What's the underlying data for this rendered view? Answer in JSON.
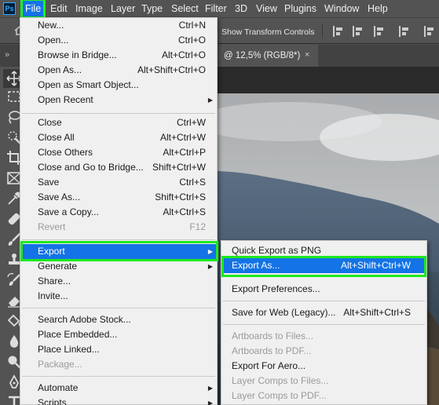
{
  "app": {
    "logo": "Ps"
  },
  "menubar": {
    "items": [
      "File",
      "Edit",
      "Image",
      "Layer",
      "Type",
      "Select",
      "Filter",
      "3D",
      "View",
      "Plugins",
      "Window",
      "Help"
    ]
  },
  "options": {
    "show_transform_controls": "Show Transform Controls",
    "show_transform_checked": false
  },
  "tabs": {
    "collapse_glyph": "»",
    "document_title": "@ 12,5% (RGB/8*)",
    "close_glyph": "×"
  },
  "file_menu": {
    "items": [
      {
        "label": "New...",
        "shortcut": "Ctrl+N"
      },
      {
        "label": "Open...",
        "shortcut": "Ctrl+O"
      },
      {
        "label": "Browse in Bridge...",
        "shortcut": "Alt+Ctrl+O"
      },
      {
        "label": "Open As...",
        "shortcut": "Alt+Shift+Ctrl+O"
      },
      {
        "label": "Open as Smart Object...",
        "shortcut": ""
      },
      {
        "label": "Open Recent",
        "shortcut": "",
        "submenu": true
      },
      {
        "label": "Close",
        "shortcut": "Ctrl+W"
      },
      {
        "label": "Close All",
        "shortcut": "Alt+Ctrl+W"
      },
      {
        "label": "Close Others",
        "shortcut": "Alt+Ctrl+P"
      },
      {
        "label": "Close and Go to Bridge...",
        "shortcut": "Shift+Ctrl+W"
      },
      {
        "label": "Save",
        "shortcut": "Ctrl+S"
      },
      {
        "label": "Save As...",
        "shortcut": "Shift+Ctrl+S"
      },
      {
        "label": "Save a Copy...",
        "shortcut": "Alt+Ctrl+S"
      },
      {
        "label": "Revert",
        "shortcut": "F12",
        "disabled": true
      },
      {
        "label": "Export",
        "shortcut": "",
        "submenu": true,
        "highlighted": true
      },
      {
        "label": "Generate",
        "shortcut": "",
        "submenu": true
      },
      {
        "label": "Share...",
        "shortcut": ""
      },
      {
        "label": "Invite...",
        "shortcut": ""
      },
      {
        "label": "Search Adobe Stock...",
        "shortcut": ""
      },
      {
        "label": "Place Embedded...",
        "shortcut": ""
      },
      {
        "label": "Place Linked...",
        "shortcut": ""
      },
      {
        "label": "Package...",
        "shortcut": "",
        "disabled": true
      },
      {
        "label": "Automate",
        "shortcut": "",
        "submenu": true
      },
      {
        "label": "Scripts",
        "shortcut": "",
        "submenu": true
      }
    ]
  },
  "export_menu": {
    "items": [
      {
        "label": "Quick Export as PNG",
        "shortcut": ""
      },
      {
        "label": "Export As...",
        "shortcut": "Alt+Shift+Ctrl+W",
        "highlighted": true
      },
      {
        "label": "Export Preferences...",
        "shortcut": ""
      },
      {
        "label": "Save for Web (Legacy)...",
        "shortcut": "Alt+Shift+Ctrl+S"
      },
      {
        "label": "Artboards to Files...",
        "shortcut": "",
        "disabled": true
      },
      {
        "label": "Artboards to PDF...",
        "shortcut": "",
        "disabled": true
      },
      {
        "label": "Export For Aero...",
        "shortcut": ""
      },
      {
        "label": "Layer Comps to Files...",
        "shortcut": "",
        "disabled": true
      },
      {
        "label": "Layer Comps to PDF...",
        "shortcut": "",
        "disabled": true
      }
    ]
  },
  "colors": {
    "highlight": "#1473e6",
    "annotation": "#1ee81e",
    "chrome": "#535353"
  },
  "toolbar_icons": [
    "move-tool-icon",
    "marquee-tool-icon",
    "lasso-tool-icon",
    "quick-select-tool-icon",
    "crop-tool-icon",
    "frame-tool-icon",
    "eyedropper-tool-icon",
    "healing-brush-tool-icon",
    "brush-tool-icon",
    "clone-stamp-tool-icon",
    "history-brush-tool-icon",
    "eraser-tool-icon",
    "paint-bucket-tool-icon",
    "blur-tool-icon",
    "dodge-tool-icon",
    "pen-tool-icon",
    "type-tool-icon"
  ]
}
